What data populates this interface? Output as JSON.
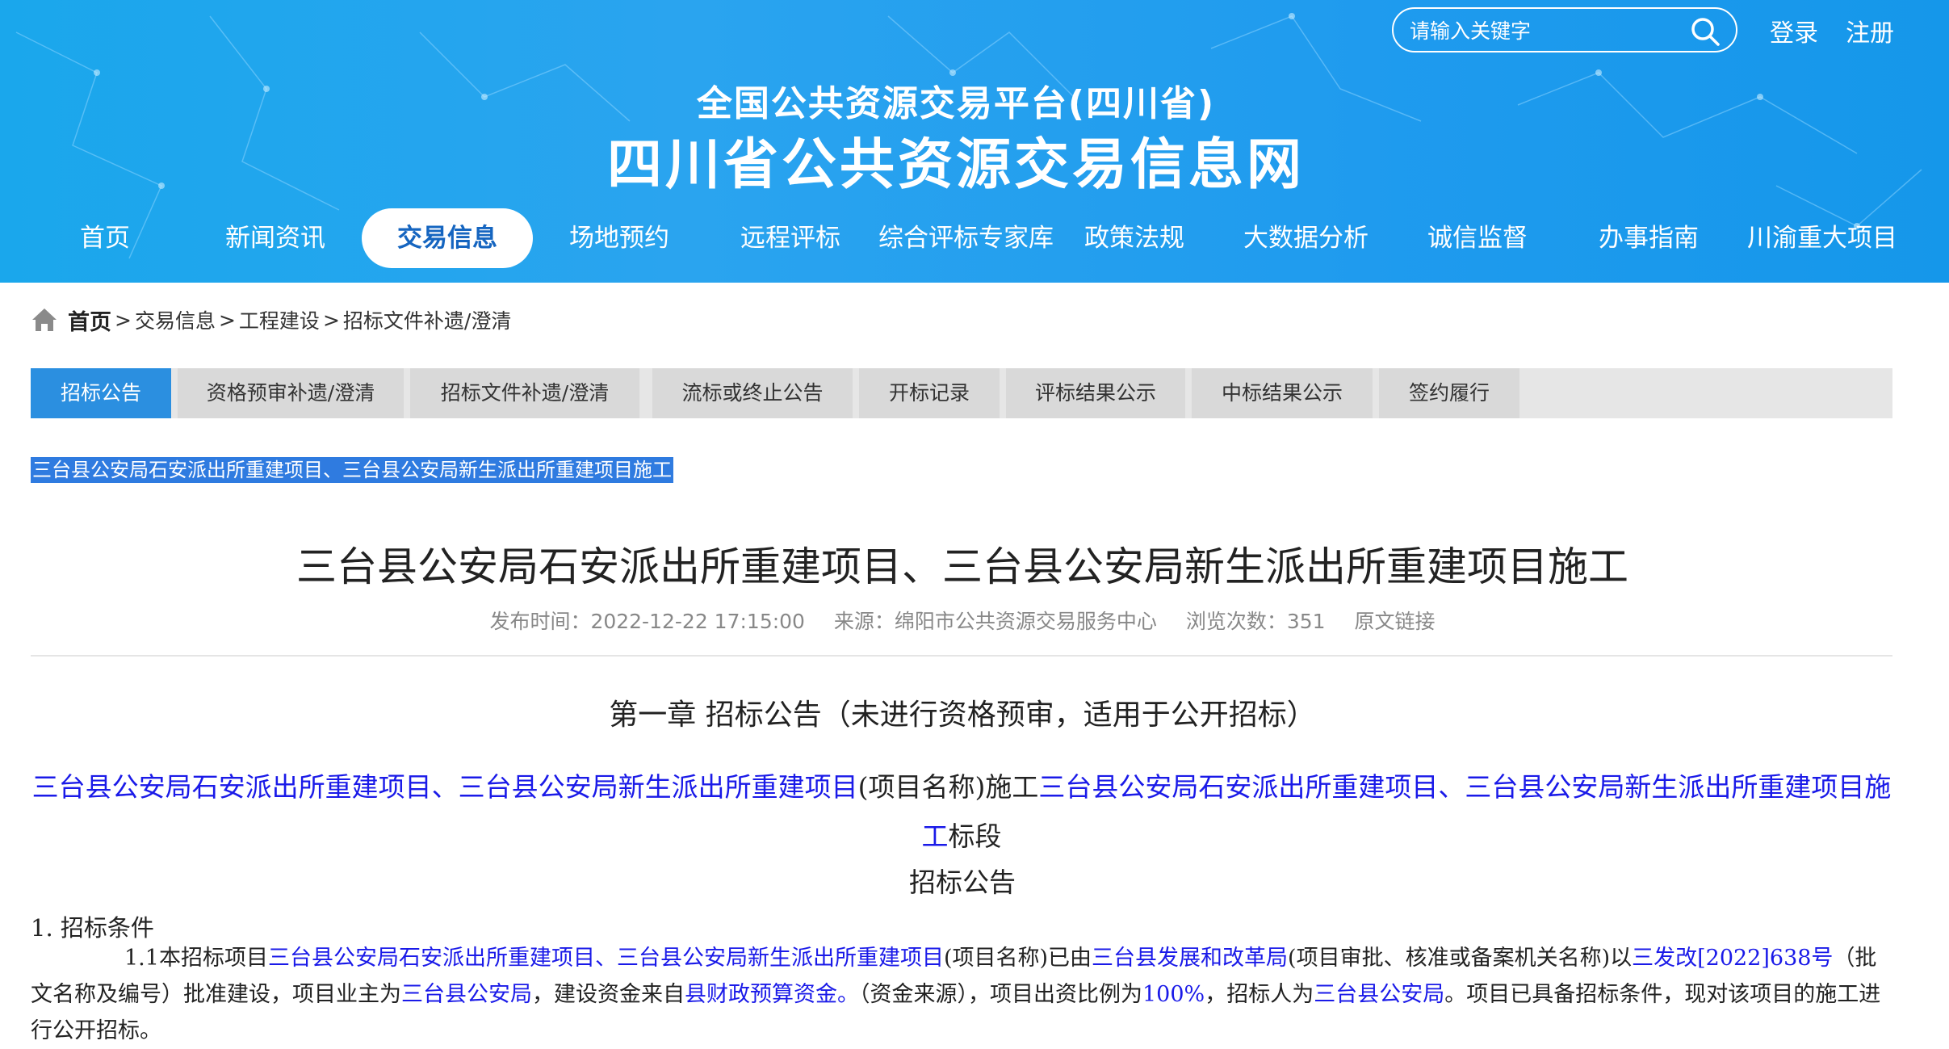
{
  "header": {
    "platform_subtitle": "全国公共资源交易平台(四川省)",
    "site_title": "四川省公共资源交易信息网",
    "search_placeholder": "请输入关键字",
    "login": "登录",
    "register": "注册"
  },
  "nav": {
    "items": [
      "首页",
      "新闻资讯",
      "交易信息",
      "场地预约",
      "远程评标",
      "综合评标专家库",
      "政策法规",
      "大数据分析",
      "诚信监督",
      "办事指南",
      "川渝重大项目"
    ],
    "active": "交易信息"
  },
  "breadcrumb": {
    "home": "首页",
    "sep": ">",
    "items": [
      "交易信息",
      "工程建设",
      "招标文件补遗/澄清"
    ]
  },
  "tabs": {
    "items": [
      "招标公告",
      "资格预审补遗/澄清",
      "招标文件补遗/澄清",
      "流标或终止公告",
      "开标记录",
      "评标结果公示",
      "中标结果公示",
      "签约履行"
    ],
    "active": "招标公告"
  },
  "selected_title": "三台县公安局石安派出所重建项目、三台县公安局新生派出所重建项目施工",
  "article": {
    "title": "三台县公安局石安派出所重建项目、三台县公安局新生派出所重建项目施工",
    "meta": {
      "publish_time": "发布时间：2022-12-22 17:15:00",
      "source": "来源：绵阳市公共资源交易服务中心",
      "views": "浏览次数：351",
      "original_link": "原文链接"
    },
    "chapter": "第一章  招标公告（未进行资格预审，适用于公开招标）",
    "project_line": {
      "p1": "三台县公安局石安派出所重建项目、三台县公安局新生派出所重建项目",
      "p2": "(项目名称)施工",
      "p3": "三台县公安局石安派出所重建项目、三台县公安局新生派出所重建项目施工",
      "p4": "标段"
    },
    "notice_heading": "招标公告",
    "section1": "1.  招标条件",
    "para": {
      "t1": "1.1本招标项目",
      "b1": "三台县公安局石安派出所重建项目、三台县公安局新生派出所重建项目",
      "t2": "(项目名称)已由",
      "b2": "三台县发展和改革局",
      "t3": "(项目审批、核准或备案机关名称)以",
      "b3": "三发改[2022]638号",
      "t4": "（批文名称及编号）批准建设，项目业主为",
      "b4": "三台县公安局",
      "t5": "，建设资金来自",
      "b5": "县财政预算资金。",
      "t6": "（资金来源），项目出资比例为",
      "b6": "100%",
      "t7": "，招标人为",
      "b7": "三台县公安局",
      "t8": "。项目已具备招标条件，现对该项目的施工进行公开招标。"
    }
  },
  "colors": {
    "banner": "#1aa7ec",
    "nav_active_text": "#1565c0",
    "tab_active": "#2b8fe0",
    "selection": "#2f7be0",
    "link_blue": "#1a1ae8"
  }
}
